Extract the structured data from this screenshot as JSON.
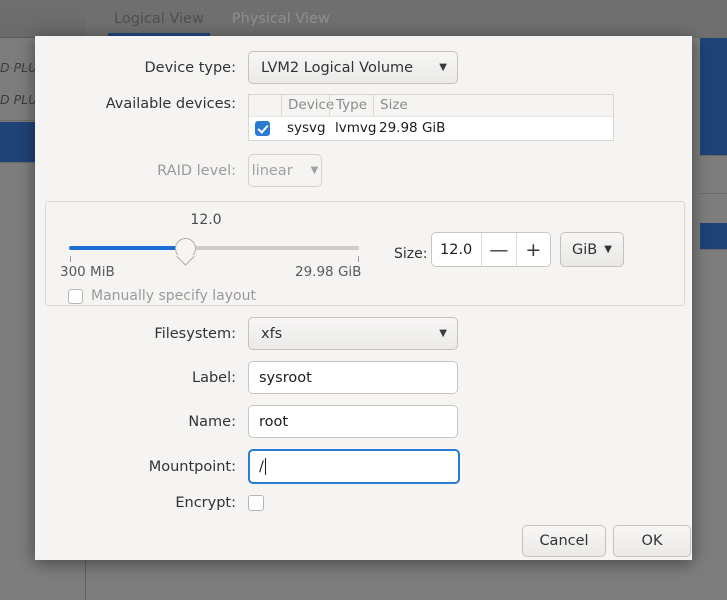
{
  "background": {
    "tabs": [
      {
        "label": "Logical View",
        "active": true
      },
      {
        "label": "Physical View",
        "active": false
      }
    ],
    "sidebar_items": [
      {
        "label": "D PLUS"
      },
      {
        "label": "D PLUS"
      }
    ],
    "accent_color": "#1f4377",
    "dim_color": "#7d7d7d"
  },
  "dialog": {
    "device_type": {
      "label": "Device type:",
      "value": "LVM2 Logical Volume",
      "icon": "chevron-down-icon"
    },
    "available_devices": {
      "label": "Available devices:",
      "columns": [
        "",
        "Device",
        "Type",
        "Size"
      ],
      "rows": [
        {
          "checked": true,
          "device": "sysvg",
          "type": "lvmvg",
          "size": "29.98 GiB"
        }
      ]
    },
    "raid_level": {
      "label": "RAID level:",
      "value": "linear",
      "disabled": true,
      "icon": "chevron-down-icon"
    },
    "size_panel": {
      "slider_value": "12.0",
      "slider_min_label": "300 MiB",
      "slider_max_label": "29.98 GiB",
      "slider_percent": 40,
      "size_label": "Size:",
      "size_value": "12.0",
      "minus_label": "—",
      "plus_label": "+",
      "unit_value": "GiB",
      "unit_icon": "chevron-down-icon",
      "manual_layout": {
        "label": "Manually specify layout",
        "checked": false,
        "disabled": true
      }
    },
    "filesystem": {
      "label": "Filesystem:",
      "value": "xfs",
      "icon": "chevron-down-icon"
    },
    "label_field": {
      "label": "Label:",
      "value": "sysroot",
      "placeholder": ""
    },
    "name_field": {
      "label": "Name:",
      "value": "root",
      "placeholder": ""
    },
    "mountpoint_field": {
      "label": "Mountpoint:",
      "value": "/",
      "placeholder": "",
      "focused": true
    },
    "encrypt": {
      "label": "Encrypt:",
      "checked": false
    },
    "buttons": {
      "cancel": "Cancel",
      "ok": "OK"
    },
    "accent_focus_color": "#2a7bd4"
  }
}
